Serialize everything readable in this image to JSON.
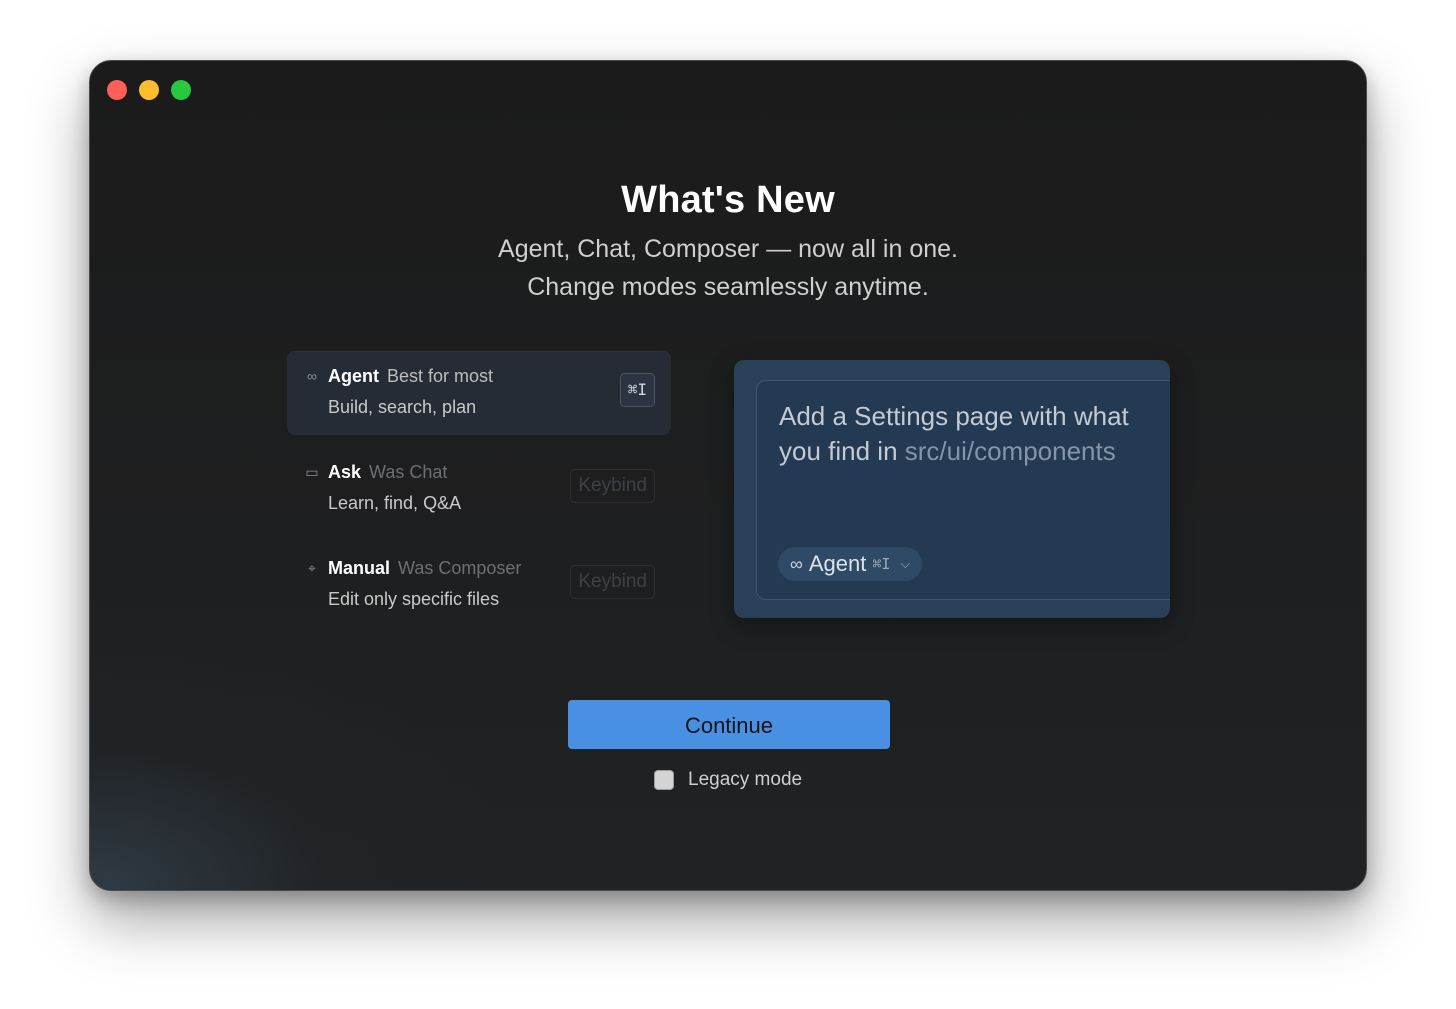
{
  "window": {
    "controls": [
      "close",
      "minimize",
      "maximize"
    ]
  },
  "header": {
    "title": "What's New",
    "subtitle_line1": "Agent, Chat, Composer — now all in one.",
    "subtitle_line2": "Change modes seamlessly anytime."
  },
  "modes": [
    {
      "icon": "infinity-icon",
      "glyph": "∞",
      "name": "Agent",
      "hint": "Best for most",
      "description": "Build, search, plan",
      "keybind": "⌘I",
      "selected": true
    },
    {
      "icon": "chat-bubble-icon",
      "glyph": "▭",
      "name": "Ask",
      "hint": "Was Chat",
      "description": "Learn, find, Q&A",
      "keybind": "Keybind",
      "selected": false
    },
    {
      "icon": "crosshair-icon",
      "glyph": "⌖",
      "name": "Manual",
      "hint": "Was Composer",
      "description": "Edit only specific files",
      "keybind": "Keybind",
      "selected": false
    }
  ],
  "preview": {
    "prompt_text": "Add a Settings page with what you find in ",
    "prompt_path": "src/ui/components",
    "mode_pill": {
      "icon": "infinity-icon",
      "glyph": "∞",
      "label": "Agent",
      "keybind": "⌘I",
      "chevron": "⌵"
    }
  },
  "actions": {
    "continue_label": "Continue",
    "legacy_label": "Legacy mode",
    "legacy_checked": false
  },
  "colors": {
    "accent": "#4a90e2",
    "window_bg": "#1b1b1b",
    "preview_bg": "#2a4058",
    "selected_mode_bg": "#262c36"
  }
}
